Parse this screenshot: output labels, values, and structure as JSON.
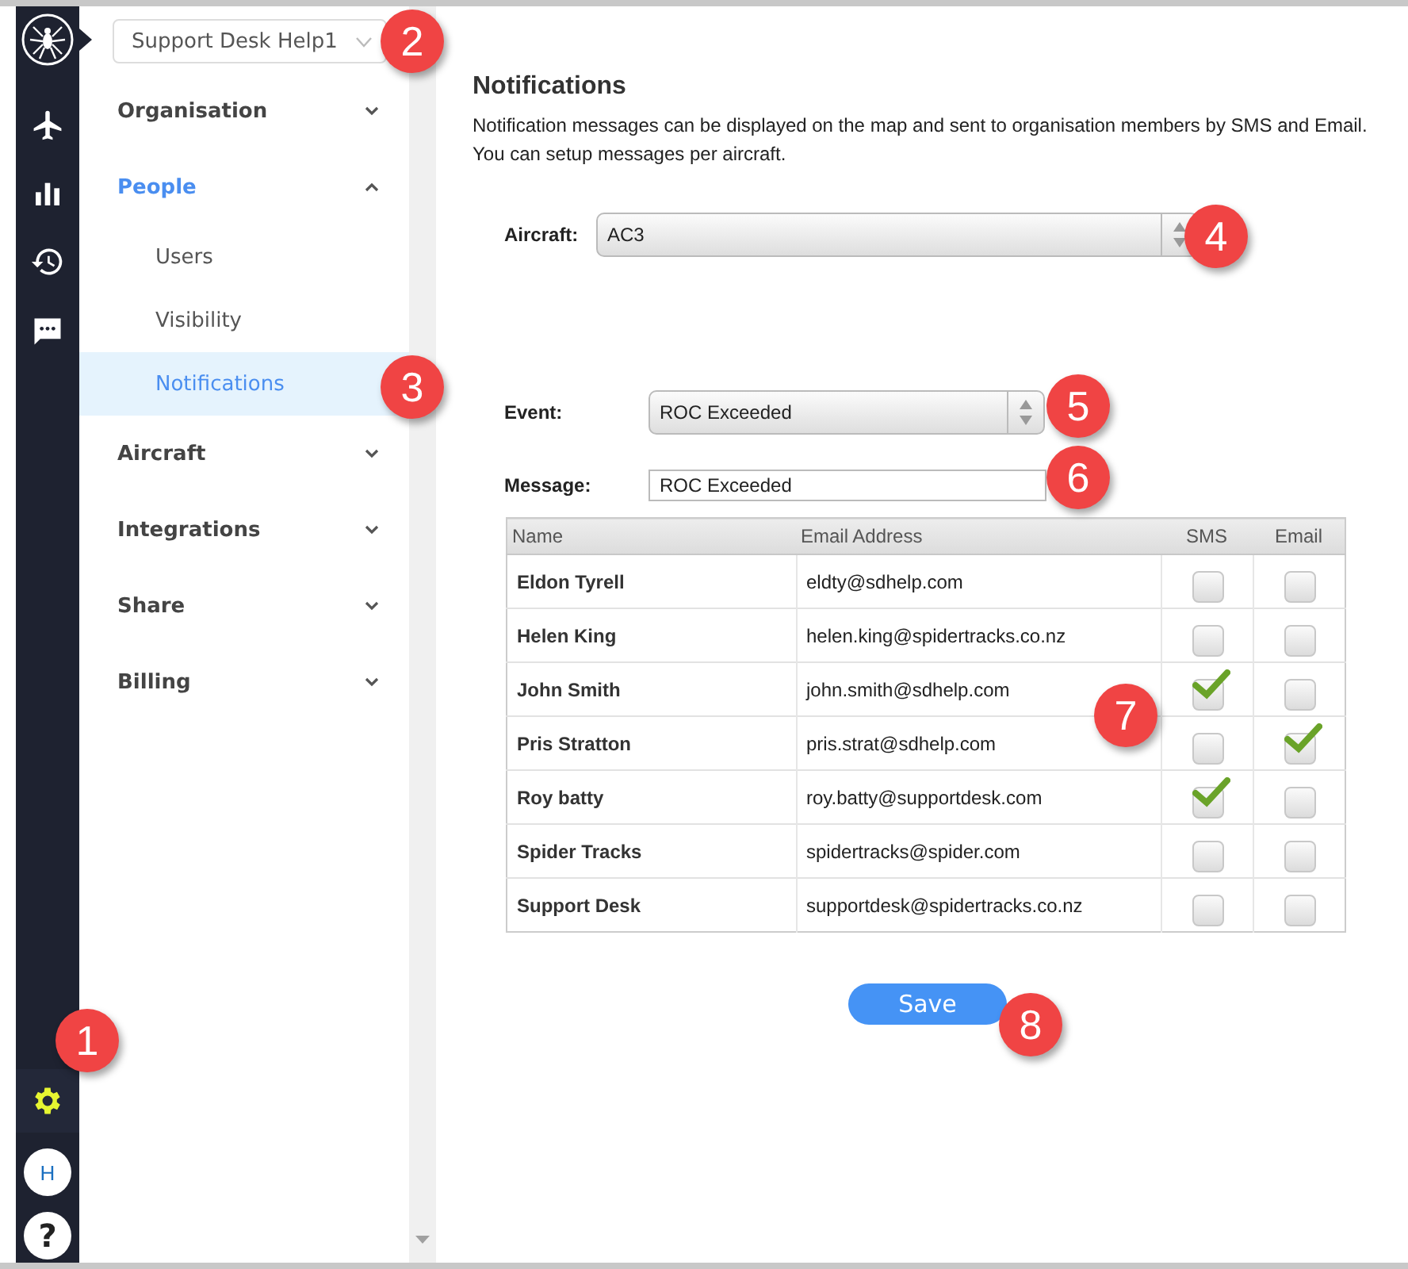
{
  "rail": {
    "settings_active": true,
    "avatar": "H",
    "help": "?"
  },
  "org_select": {
    "value": "Support Desk Help1"
  },
  "nav": [
    {
      "label": "Organisation",
      "expanded": false
    },
    {
      "label": "People",
      "expanded": true,
      "children": [
        {
          "label": "Users",
          "selected": false
        },
        {
          "label": "Visibility",
          "selected": false
        },
        {
          "label": "Notifications",
          "selected": true
        }
      ]
    },
    {
      "label": "Aircraft",
      "expanded": false
    },
    {
      "label": "Integrations",
      "expanded": false
    },
    {
      "label": "Share",
      "expanded": false
    },
    {
      "label": "Billing",
      "expanded": false
    }
  ],
  "page": {
    "title": "Notifications",
    "description": [
      "Notification messages can be displayed on the map and sent to organisation members by SMS and Email.",
      "You can setup messages per aircraft."
    ]
  },
  "aircraft": {
    "label": "Aircraft:",
    "value": "AC3"
  },
  "event": {
    "label": "Event:",
    "value": "ROC Exceeded"
  },
  "message": {
    "label": "Message:",
    "value": "ROC Exceeded"
  },
  "table": {
    "columns": [
      "Name",
      "Email Address",
      "SMS",
      "Email"
    ],
    "rows": [
      {
        "name": "Eldon Tyrell",
        "email": "eldty@sdhelp.com",
        "sms": false,
        "email_on": false
      },
      {
        "name": "Helen King",
        "email": "helen.king@spidertracks.co.nz",
        "sms": false,
        "email_on": false
      },
      {
        "name": "John Smith",
        "email": "john.smith@sdhelp.com",
        "sms": true,
        "email_on": false
      },
      {
        "name": "Pris Stratton",
        "email": "pris.strat@sdhelp.com",
        "sms": false,
        "email_on": true
      },
      {
        "name": "Roy batty",
        "email": "roy.batty@supportdesk.com",
        "sms": true,
        "email_on": false
      },
      {
        "name": "Spider Tracks",
        "email": "spidertracks@spider.com",
        "sms": false,
        "email_on": false
      },
      {
        "name": "Support Desk",
        "email": "supportdesk@spidertracks.co.nz",
        "sms": false,
        "email_on": false
      }
    ]
  },
  "save_button": "Save",
  "callouts": [
    "1",
    "2",
    "3",
    "4",
    "5",
    "6",
    "7",
    "8"
  ]
}
